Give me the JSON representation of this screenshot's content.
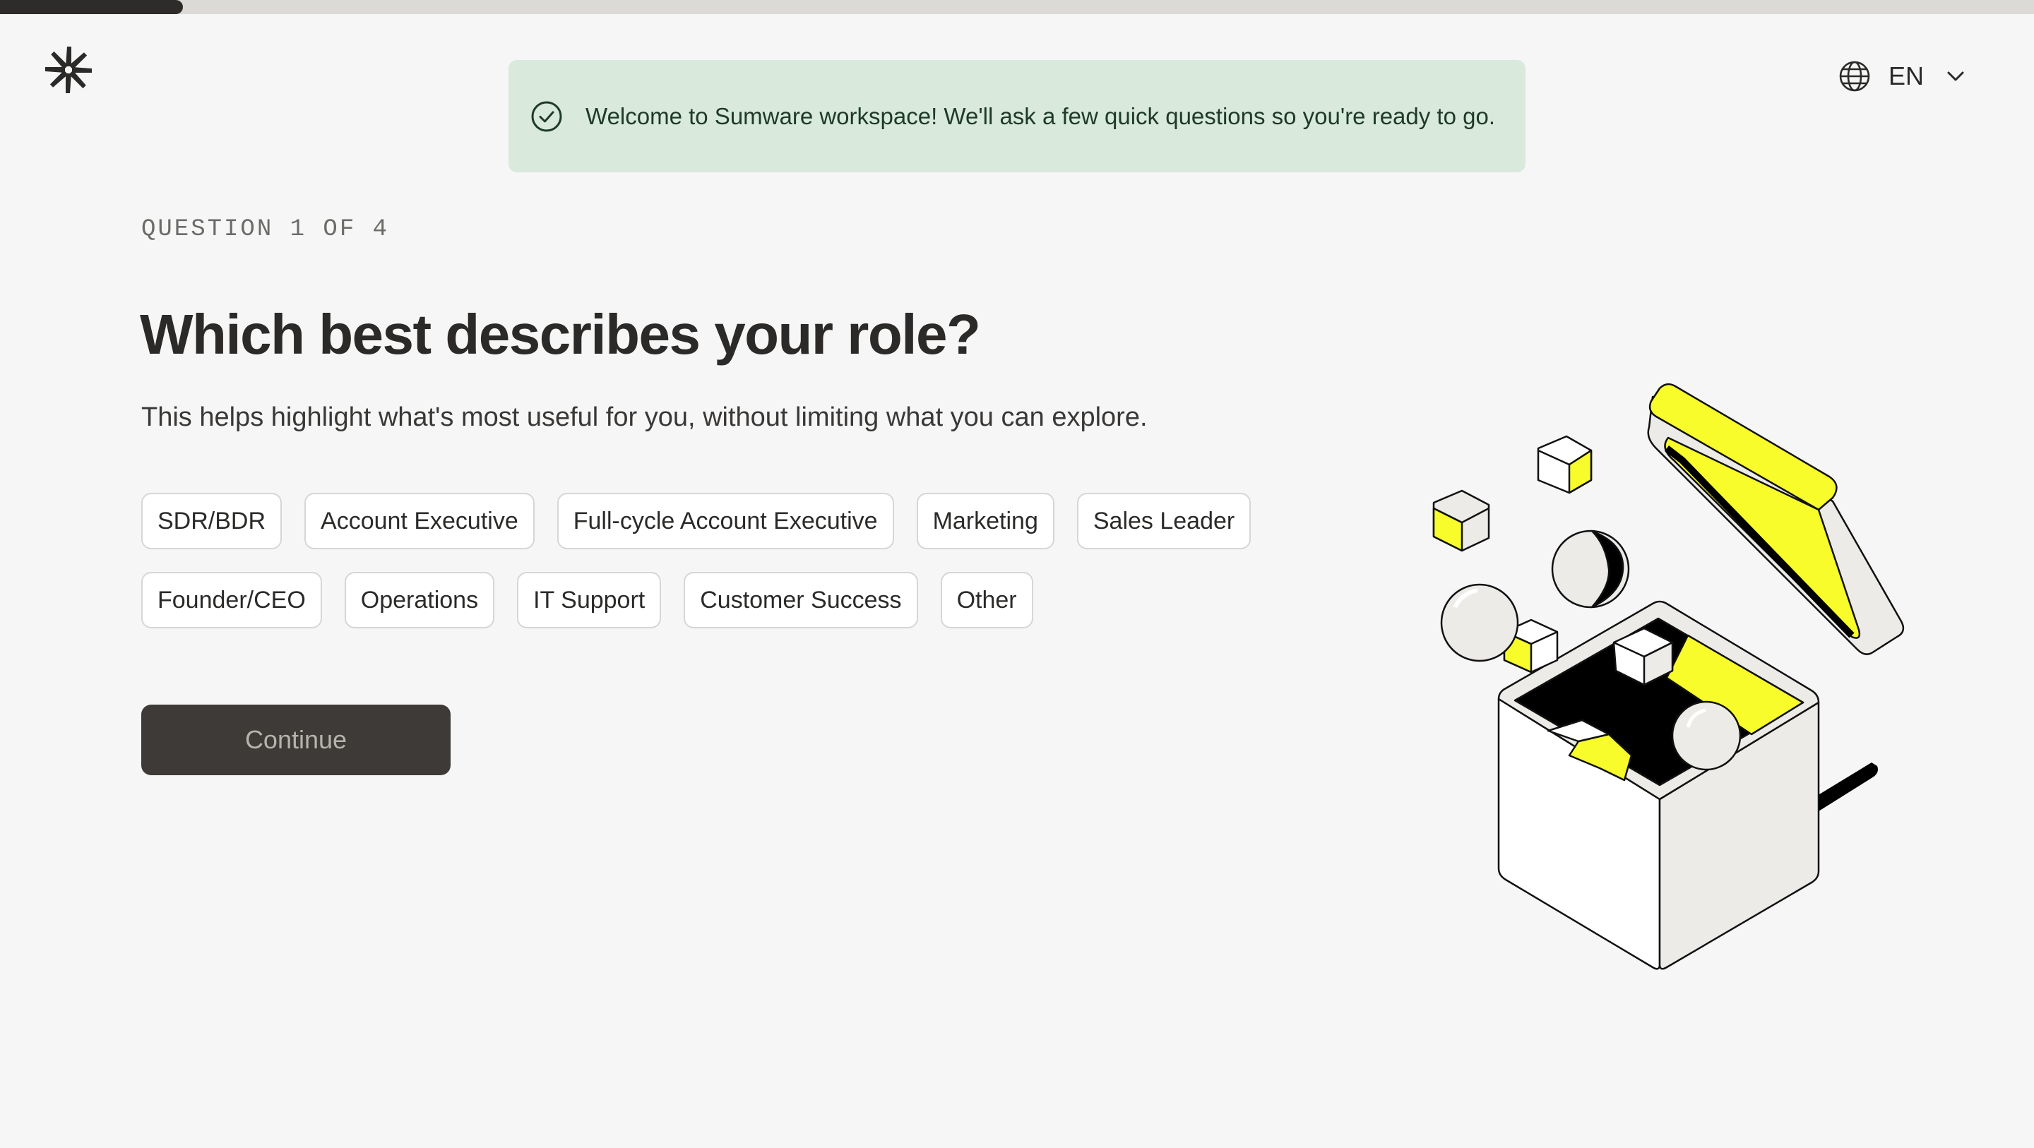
{
  "progress": {
    "fraction": 0.09,
    "fill_color": "#2e2c2a",
    "track_color": "#dcdad6"
  },
  "logo": {
    "icon": "asterisk-logo-icon"
  },
  "banner": {
    "icon": "check-circle-icon",
    "message": "Welcome to Sumware workspace! We'll ask a few quick questions so you're ready to go.",
    "background": "#d9e9dc"
  },
  "language": {
    "icon": "globe-icon",
    "code": "EN",
    "dropdown_icon": "chevron-down-icon"
  },
  "question": {
    "counter": "QUESTION 1 OF 4",
    "title": "Which best describes your role?",
    "subtitle": "This helps highlight what's most useful for you, without limiting what you can explore."
  },
  "roles": {
    "row1": [
      "SDR/BDR",
      "Account Executive",
      "Full-cycle Account Executive",
      "Marketing",
      "Sales Leader"
    ],
    "row2": [
      "Founder/CEO",
      "Operations",
      "IT Support",
      "Customer Success",
      "Other"
    ]
  },
  "continue_label": "Continue",
  "colors": {
    "accent_yellow": "#f8fc2a",
    "button_dark": "#3d3a37"
  },
  "illustration": {
    "description_icon": "open-box-illustration"
  }
}
